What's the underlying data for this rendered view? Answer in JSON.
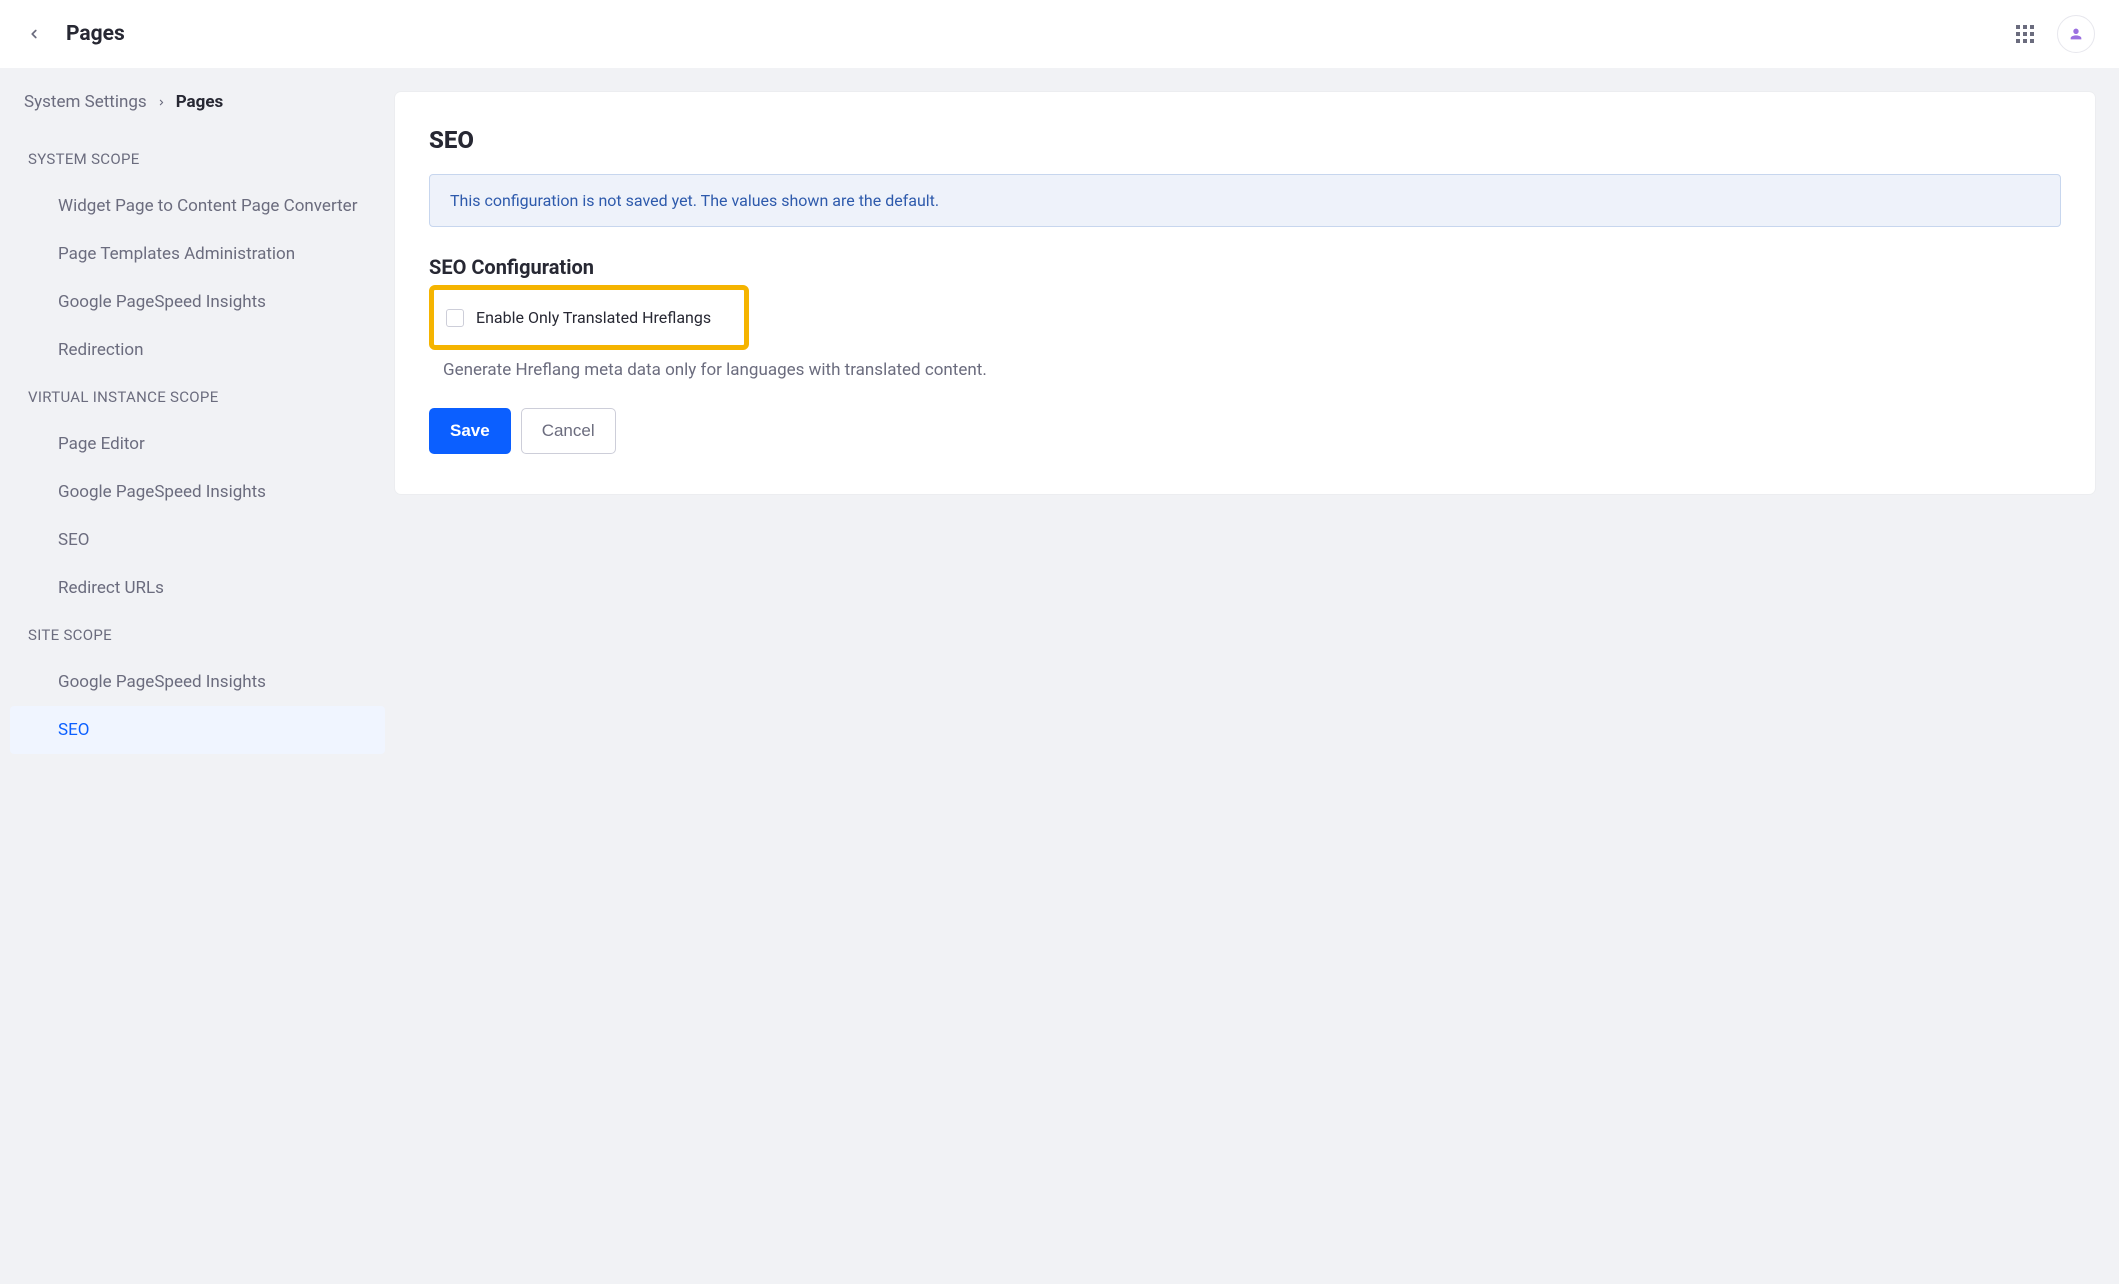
{
  "header": {
    "title": "Pages"
  },
  "breadcrumb": {
    "parent": "System Settings",
    "current": "Pages"
  },
  "sidebar": {
    "groups": [
      {
        "header": "SYSTEM SCOPE",
        "items": [
          {
            "label": "Widget Page to Content Page Converter",
            "active": false
          },
          {
            "label": "Page Templates Administration",
            "active": false
          },
          {
            "label": "Google PageSpeed Insights",
            "active": false
          },
          {
            "label": "Redirection",
            "active": false
          }
        ]
      },
      {
        "header": "VIRTUAL INSTANCE SCOPE",
        "items": [
          {
            "label": "Page Editor",
            "active": false
          },
          {
            "label": "Google PageSpeed Insights",
            "active": false
          },
          {
            "label": "SEO",
            "active": false
          },
          {
            "label": "Redirect URLs",
            "active": false
          }
        ]
      },
      {
        "header": "SITE SCOPE",
        "items": [
          {
            "label": "Google PageSpeed Insights",
            "active": false
          },
          {
            "label": "SEO",
            "active": true
          }
        ]
      }
    ]
  },
  "main": {
    "heading": "SEO",
    "alert": "This configuration is not saved yet. The values shown are the default.",
    "section_heading": "SEO Configuration",
    "checkbox_label": "Enable Only Translated Hreflangs",
    "description": "Generate Hreflang meta data only for languages with translated content.",
    "save_label": "Save",
    "cancel_label": "Cancel"
  }
}
